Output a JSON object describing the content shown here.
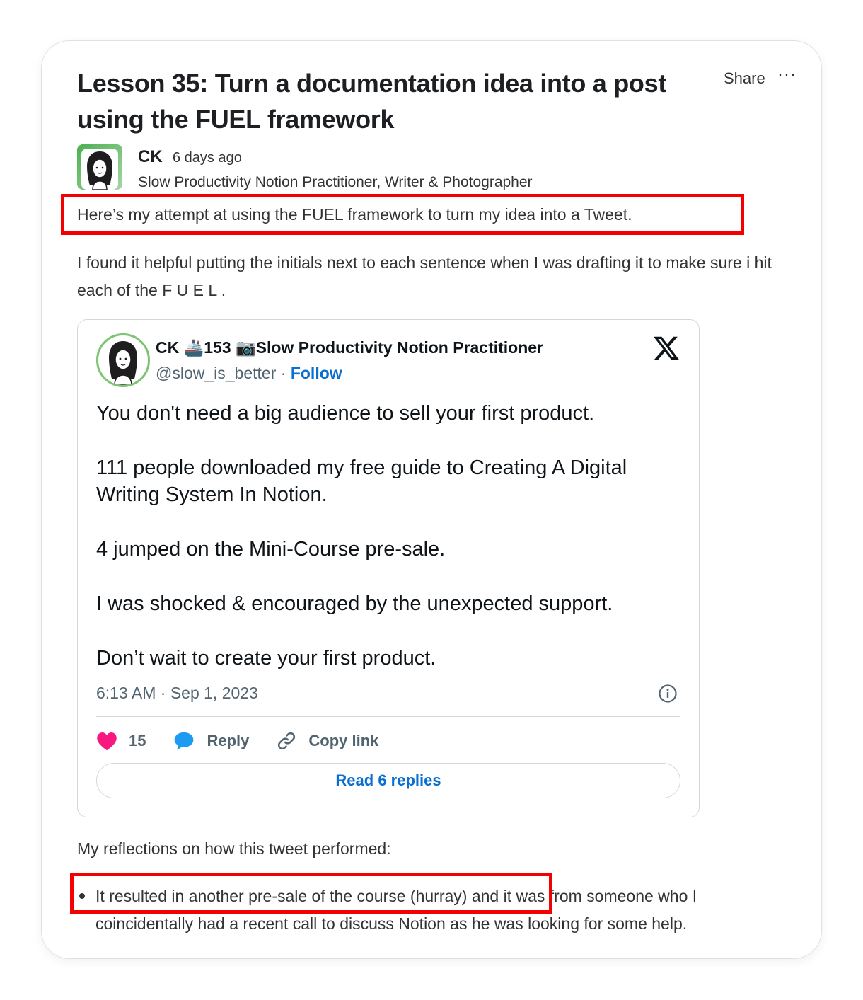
{
  "post": {
    "title": "Lesson 35: Turn a documentation idea into a post using the FUEL framework",
    "share_label": "Share",
    "more_label": "···",
    "author": {
      "name": "CK",
      "time_ago": "6 days ago",
      "bio": "Slow Productivity Notion Practitioner, Writer & Photographer"
    },
    "paragraph_1": "Here’s my attempt at using the FUEL framework to turn my idea into a Tweet.",
    "paragraph_2": "I found it helpful putting the initials next to each sentence when I was drafting it to make sure i hit each of the F U E L .",
    "paragraph_3": "My reflections on how this tweet performed:",
    "bullets": [
      "It resulted in another pre-sale of the course (hurray) and it was from someone who I coincidentally had a recent call to discuss Notion as he was looking for some help."
    ]
  },
  "tweet": {
    "display_name": "CK 🚢153 📷Slow Productivity Notion Practitioner",
    "handle": "@slow_is_better",
    "separator": " · ",
    "follow_label": "Follow",
    "body": [
      "You don't need a big audience to sell your first product.",
      "111 people downloaded my free guide to Creating A Digital Writing System In Notion.",
      "4 jumped on the Mini-Course pre-sale.",
      "I was shocked & encouraged by the unexpected support.",
      "Don’t wait to create your first product."
    ],
    "timestamp": "6:13 AM · Sep 1, 2023",
    "likes": "15",
    "reply_label": "Reply",
    "copy_link_label": "Copy link",
    "read_replies_label": "Read 6 replies",
    "colors": {
      "like": "#f91880",
      "reply": "#1d9bf0",
      "link": "#0a6fcf"
    }
  },
  "highlight_color": "#f40000"
}
